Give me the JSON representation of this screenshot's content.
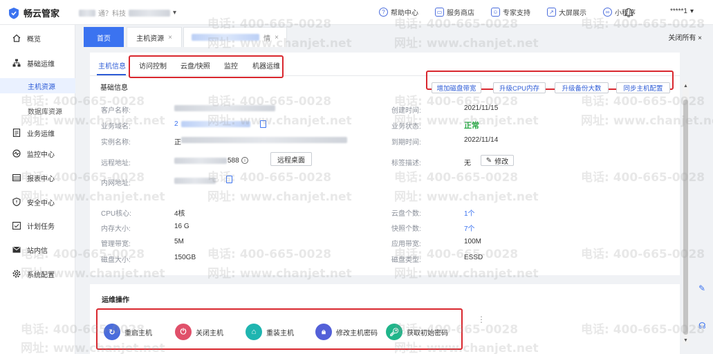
{
  "app": {
    "title": "畅云管家",
    "brand_color": "#3b73f0"
  },
  "company": {
    "name_prefix": "通？科技",
    "arrow": "▾"
  },
  "topnav": [
    {
      "label": "帮助中心",
      "icon": "question-icon"
    },
    {
      "label": "服务商店",
      "icon": "store-icon"
    },
    {
      "label": "专家支持",
      "icon": "expert-icon"
    },
    {
      "label": "大屏展示",
      "icon": "chart-icon"
    },
    {
      "label": "小程序",
      "icon": "miniprogram-icon"
    }
  ],
  "user": {
    "name": "*****1",
    "arrow": "▾"
  },
  "sidebar": {
    "items": [
      {
        "label": "概览",
        "icon": "home-icon"
      },
      {
        "label": "基础运维",
        "icon": "server-icon"
      },
      {
        "label": "业务运维",
        "icon": "doc-icon"
      },
      {
        "label": "监控中心",
        "icon": "monitor-icon"
      },
      {
        "label": "报表中心",
        "icon": "report-icon"
      },
      {
        "label": "安全中心",
        "icon": "shield-icon"
      },
      {
        "label": "计划任务",
        "icon": "calendar-icon"
      },
      {
        "label": "站内信",
        "icon": "mail-icon"
      },
      {
        "label": "系统配置",
        "icon": "gear-icon"
      }
    ],
    "subitems": [
      {
        "label": "主机资源",
        "active": true
      },
      {
        "label": "数据库资源",
        "active": false
      }
    ]
  },
  "page_tabs": {
    "home": "首页",
    "host_resources": "主机资源",
    "detail_suffix": "情",
    "close_all": "关闭所有",
    "close_symbol": "×"
  },
  "subtabs": [
    "主机信息",
    "访问控制",
    "云盘/快照",
    "监控",
    "机器运维"
  ],
  "basic_info": {
    "title": "基础信息",
    "actions": [
      "增加磁盘带宽",
      "升级CPU内存",
      "升级备份大数",
      "同步主机配置"
    ],
    "left_fields": [
      {
        "label": "客户名称:",
        "value": ""
      },
      {
        "label": "业务域名:",
        "value": "2"
      },
      {
        "label": "实例名称:",
        "value": "正"
      },
      {
        "label": "远程地址:",
        "value": "588"
      },
      {
        "label": "内网地址:",
        "value": ""
      },
      {
        "label": "CPU核心:",
        "value": "4核"
      },
      {
        "label": "内存大小:",
        "value": "16 G"
      },
      {
        "label": "管理带宽:",
        "value": "5M"
      },
      {
        "label": "磁盘大小:",
        "value": "150GB"
      }
    ],
    "right_fields": [
      {
        "label": "创建时间:",
        "value": "2021/11/15"
      },
      {
        "label": "业务状态:",
        "value": "正常"
      },
      {
        "label": "到期时间:",
        "value": "2022/11/14"
      },
      {
        "label": "标签描述:",
        "value": "无"
      },
      {
        "label": "云盘个数:",
        "value": "1个"
      },
      {
        "label": "快照个数:",
        "value": "7个"
      },
      {
        "label": "应用带宽:",
        "value": "100M"
      },
      {
        "label": "磁盘类型:",
        "value": "ESSD"
      }
    ],
    "remote_desktop": "远程桌面",
    "edit": "修改"
  },
  "ops": {
    "title": "运维操作",
    "items": [
      {
        "label": "重启主机",
        "color": "#4a6cdc",
        "icon": "restart-icon"
      },
      {
        "label": "关闭主机",
        "color": "#e0506a",
        "icon": "power-icon"
      },
      {
        "label": "重装主机",
        "color": "#1fb5b0",
        "icon": "reinstall-icon"
      },
      {
        "label": "修改主机密码",
        "color": "#5360d8",
        "icon": "lock-icon"
      },
      {
        "label": "获取初始密码",
        "color": "#20b58a",
        "icon": "key-icon"
      }
    ]
  },
  "watermark": {
    "phone": "电话: 400-665-0028",
    "site": "网址: www.chanjet.net"
  }
}
